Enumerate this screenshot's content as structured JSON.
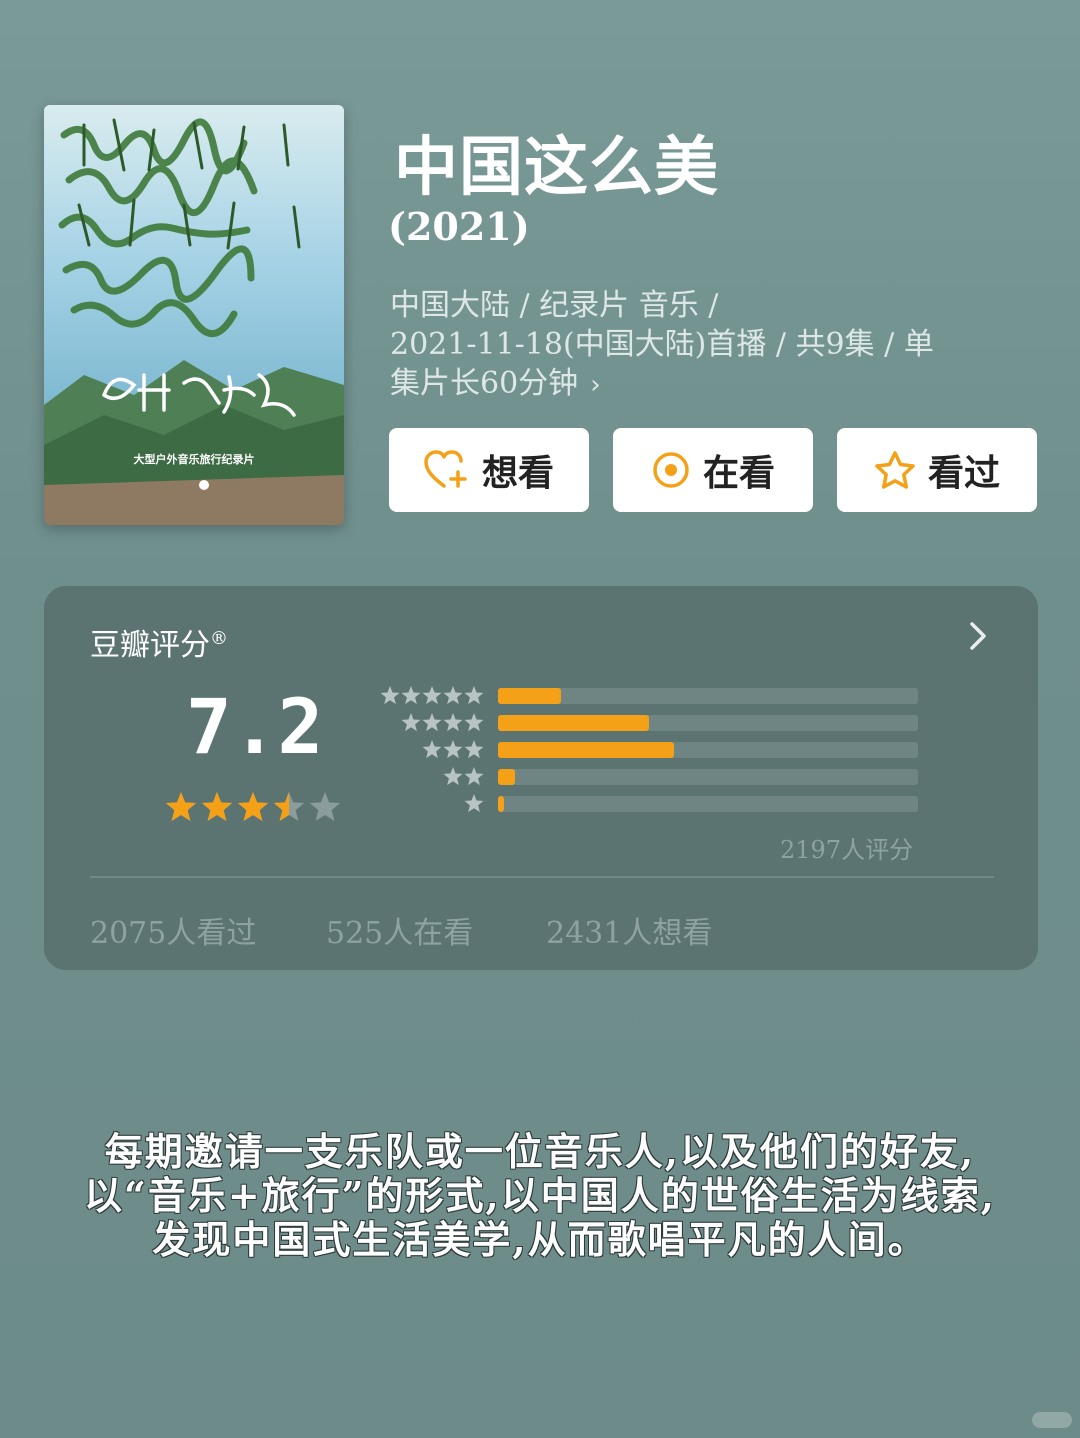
{
  "header": {
    "title": "中国这么美",
    "year": "(2021)",
    "meta_line1": "中国大陆 / 纪录片 音乐 /",
    "meta_line2": "2021-11-18(中国大陆)首播 / 共9集 / 单",
    "meta_line3": "集片长60分钟",
    "meta_chevron": "›"
  },
  "poster": {
    "caption": "大型户外音乐旅行纪录片"
  },
  "actions": {
    "want_label": "想看",
    "watching_label": "在看",
    "watched_label": "看过",
    "icon_color": "#f5a117"
  },
  "rating": {
    "title": "豆瓣评分",
    "registered": "®",
    "score": "7.2",
    "stars": 3.5,
    "max_stars": 5,
    "distribution": [
      {
        "stars": 5,
        "fraction": 0.15
      },
      {
        "stars": 4,
        "fraction": 0.36
      },
      {
        "stars": 3,
        "fraction": 0.42
      },
      {
        "stars": 2,
        "fraction": 0.04
      },
      {
        "stars": 1,
        "fraction": 0.015
      }
    ],
    "count_label": "2197人评分",
    "bar_color": "#f5a117"
  },
  "stats": {
    "watched": "2075人看过",
    "watching": "525人在看",
    "want": "2431人想看"
  },
  "description": {
    "line1": "每期邀请一支乐队或一位音乐人,以及他们的好友,",
    "line2": "以“音乐+旅行”的形式,以中国人的世俗生活为线索,",
    "line3": "发现中国式生活美学,从而歌唱平凡的人间。"
  }
}
